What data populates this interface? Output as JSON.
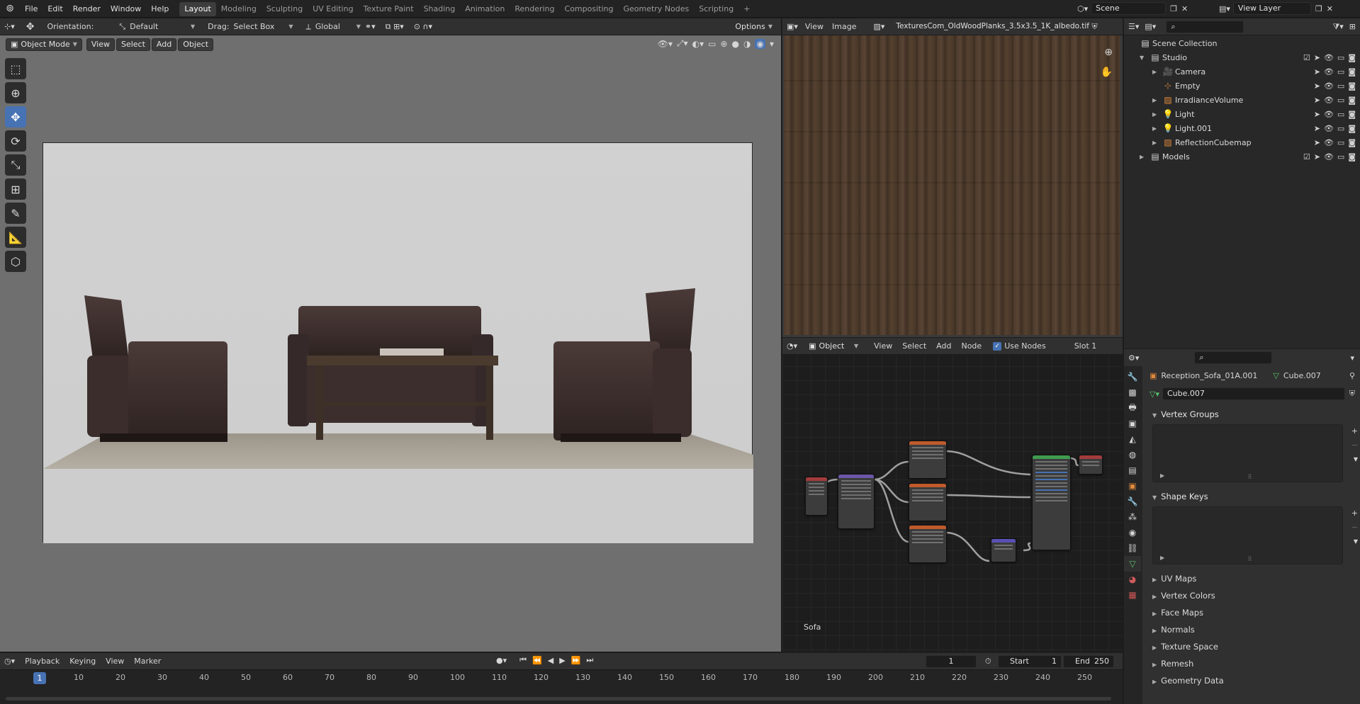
{
  "menu": [
    "File",
    "Edit",
    "Render",
    "Window",
    "Help"
  ],
  "workspaces": [
    "Layout",
    "Modeling",
    "Sculpting",
    "UV Editing",
    "Texture Paint",
    "Shading",
    "Animation",
    "Rendering",
    "Compositing",
    "Geometry Nodes",
    "Scripting"
  ],
  "active_workspace": "Layout",
  "add_workspace": "+",
  "scene": {
    "value": "Scene"
  },
  "view_layer": {
    "value": "View Layer"
  },
  "viewport": {
    "orientation_label": "Orientation:",
    "orientation_value": "Default",
    "drag_label": "Drag:",
    "drag_value": "Select Box",
    "transform_space": "Global",
    "options": "Options",
    "mode": "Object Mode",
    "menus": [
      "View",
      "Select",
      "Add",
      "Object"
    ]
  },
  "image_editor": {
    "menus": [
      "View",
      "Image"
    ],
    "image_name": "TexturesCom_OldWoodPlanks_3.5x3.5_1K_albedo.tif"
  },
  "node_editor": {
    "type": "Object",
    "menus": [
      "View",
      "Select",
      "Add",
      "Node"
    ],
    "use_nodes": "Use Nodes",
    "slot": "Slot 1",
    "material_name": "Sofa"
  },
  "outliner": {
    "collection_root": "Scene Collection",
    "items": [
      {
        "name": "Studio",
        "type": "collection"
      },
      {
        "name": "Camera",
        "type": "camera"
      },
      {
        "name": "Empty",
        "type": "empty"
      },
      {
        "name": "IrradianceVolume",
        "type": "probe"
      },
      {
        "name": "Light",
        "type": "light"
      },
      {
        "name": "Light.001",
        "type": "light"
      },
      {
        "name": "ReflectionCubemap",
        "type": "probe"
      },
      {
        "name": "Models",
        "type": "collection"
      }
    ]
  },
  "properties": {
    "object_name": "Reception_Sofa_01A.001",
    "mesh_name": "Cube.007",
    "data_field": "Cube.007",
    "sections": [
      "Vertex Groups",
      "Shape Keys",
      "UV Maps",
      "Vertex Colors",
      "Face Maps",
      "Normals",
      "Texture Space",
      "Remesh",
      "Geometry Data"
    ]
  },
  "timeline": {
    "menus": [
      "Playback",
      "Keying",
      "View",
      "Marker"
    ],
    "current_frame": "1",
    "start_label": "Start",
    "start": "1",
    "end_label": "End",
    "end": "250",
    "ruler": [
      "10",
      "20",
      "30",
      "40",
      "50",
      "60",
      "70",
      "80",
      "90",
      "100",
      "110",
      "120",
      "130",
      "140",
      "150",
      "160",
      "170",
      "180",
      "190",
      "200",
      "210",
      "220",
      "230",
      "240",
      "250"
    ],
    "playhead": "1"
  },
  "colors": {
    "accent": "#4772b3",
    "background": "#1d1d1d",
    "header": "#303030"
  }
}
